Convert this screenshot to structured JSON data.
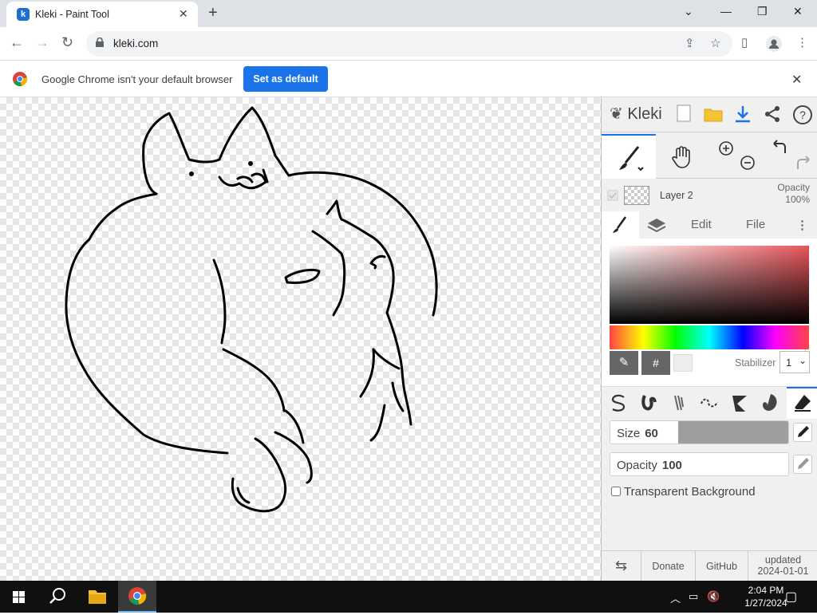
{
  "browser": {
    "tab_title": "Kleki - Paint Tool",
    "url": "kleki.com",
    "infobar_text": "Google Chrome isn't your default browser",
    "infobar_button": "Set as default"
  },
  "app": {
    "logo_text": "Kleki",
    "layer": {
      "name": "Layer 2",
      "opacity_label": "Opacity",
      "opacity_value": "100%"
    },
    "subtabs": {
      "edit": "Edit",
      "file": "File"
    },
    "stabilizer": {
      "label": "Stabilizer",
      "value": "1"
    },
    "size": {
      "label": "Size",
      "value": "60",
      "fraction": 0.38
    },
    "opacity": {
      "label": "Opacity",
      "value": "100",
      "fraction": 1.0
    },
    "transparent_bg": "Transparent Background",
    "footer": {
      "donate": "Donate",
      "github": "GitHub",
      "updated_line1": "updated",
      "updated_line2": "2024-01-01"
    },
    "colors": {
      "accent": "#1a73e8",
      "primary": "#e8555b"
    }
  },
  "taskbar": {
    "time": "2:04 PM",
    "date": "1/27/2024"
  }
}
